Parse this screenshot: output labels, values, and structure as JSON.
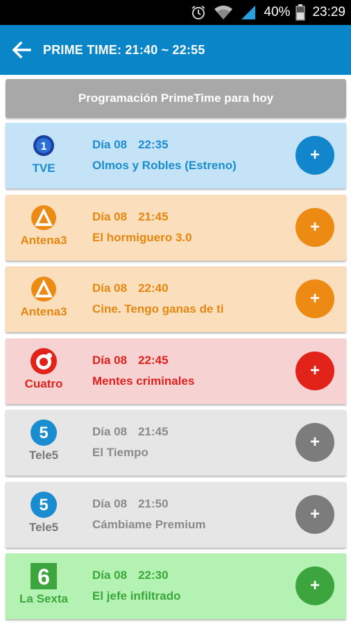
{
  "status_bar": {
    "battery_percent": "40%",
    "time": "23:29",
    "icons": [
      "alarm-clock-icon",
      "wifi-icon",
      "signal-icon",
      "battery-icon"
    ]
  },
  "app_bar": {
    "back_icon": "arrow-left-icon",
    "title": "PRIME TIME: 21:40 ~ 22:55",
    "color": "#0a86c8"
  },
  "section_button": "Programación PrimeTime para hoy",
  "programs": [
    {
      "channel": "TVE",
      "day": "Día 08",
      "time": "22:35",
      "title": "Olmos y Robles (Estreno)",
      "color": "#1a8dd0",
      "add": "+"
    },
    {
      "channel": "Antena3",
      "day": "Día 08",
      "time": "21:45",
      "title": "El hormiguero 3.0",
      "color": "#e5860e",
      "add": "+"
    },
    {
      "channel": "Antena3",
      "day": "Día 08",
      "time": "22:40",
      "title": "Cine. Tengo ganas de ti",
      "color": "#e5860e",
      "add": "+"
    },
    {
      "channel": "Cuatro",
      "day": "Día 08",
      "time": "22:45",
      "title": "Mentes criminales",
      "color": "#e0201c",
      "add": "+"
    },
    {
      "channel": "Tele5",
      "day": "Día 08",
      "time": "21:45",
      "title": "El Tiempo",
      "color": "#8a8a8a",
      "add": "+"
    },
    {
      "channel": "Tele5",
      "day": "Día 08",
      "time": "21:50",
      "title": "Cámbiame Premium",
      "color": "#8a8a8a",
      "add": "+"
    },
    {
      "channel": "La Sexta",
      "day": "Día 08",
      "time": "22:30",
      "title": "El jefe infiltrado",
      "color": "#3aa73a",
      "add": "+"
    }
  ]
}
